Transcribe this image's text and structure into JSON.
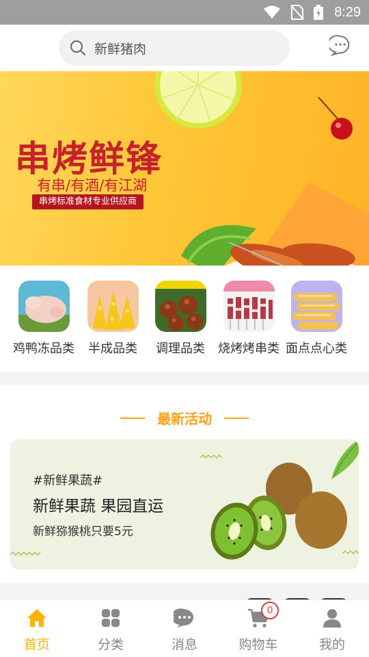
{
  "status_bar": {
    "time": "8:29"
  },
  "search": {
    "text": "新鲜猪肉",
    "icon": "search-icon"
  },
  "header": {
    "message_icon": "chat-icon"
  },
  "banner": {
    "title": "串烤鲜锋",
    "subtitle": "有串/有酒/有江湖",
    "tagline": "串烤标准食材专业供应商",
    "slide_count": 3,
    "active_slide": 1
  },
  "categories": [
    {
      "label": "鸡鸭冻品类",
      "icon": "chicken-image"
    },
    {
      "label": "半成品类",
      "icon": "fried-food-image"
    },
    {
      "label": "调理品类",
      "icon": "meatball-image"
    },
    {
      "label": "烧烤烤串类",
      "icon": "skewers-image"
    },
    {
      "label": "面点点心类",
      "icon": "fried-dough-image"
    }
  ],
  "activity": {
    "section_title": "最新活动",
    "hashtag": "#新鲜果蔬#",
    "headline": "新鲜果蔬 果园直运",
    "description": "新鲜猕猴桃只要5元"
  },
  "nav": [
    {
      "label": "首页",
      "icon": "home-icon",
      "active": true
    },
    {
      "label": "分类",
      "icon": "grid-icon",
      "active": false
    },
    {
      "label": "消息",
      "icon": "message-icon",
      "active": false
    },
    {
      "label": "购物车",
      "icon": "cart-icon",
      "active": false,
      "badge": "0"
    },
    {
      "label": "我的",
      "icon": "user-icon",
      "active": false
    }
  ],
  "colors": {
    "accent": "#ffb300",
    "banner_red": "#c5222a",
    "activity_orange": "#ffa31a"
  }
}
